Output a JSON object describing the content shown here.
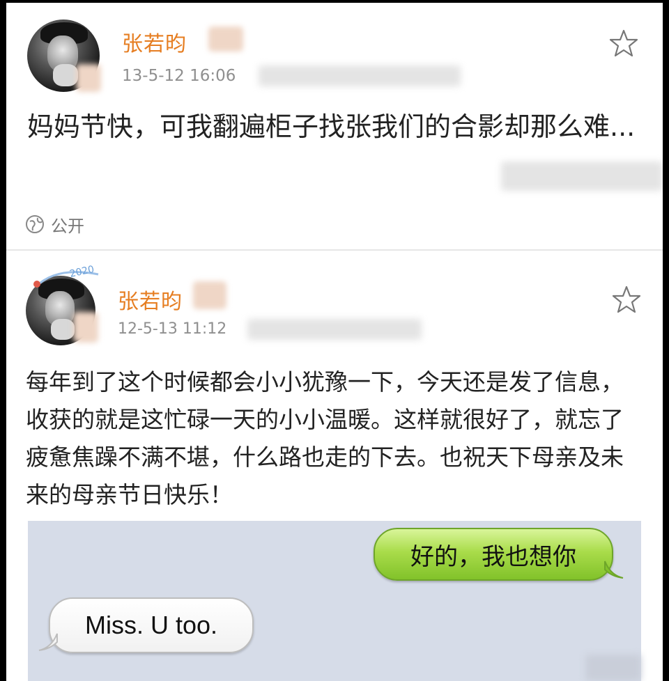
{
  "posts": [
    {
      "username": "张若昀",
      "timestamp": "13-5-12 16:06",
      "text": "妈妈节快，可我翻遍柜子找张我们的合影却那么难...",
      "privacy_label": "公开"
    },
    {
      "username": "张若昀",
      "timestamp": "12-5-13 11:12",
      "avatar_badge": "2020",
      "text": "每年到了这个时候都会小小犹豫一下，今天还是发了信息，收获的就是这忙碌一天的小小温暖。这样就很好了，就忘了疲惫焦躁不满不堪，什么路也走的下去。也祝天下母亲及未来的母亲节日快乐！"
    }
  ],
  "sms": {
    "sent_message": "好的，我也想你",
    "received_message": "Miss. U too."
  },
  "colors": {
    "username": "#e67e22",
    "timestamp": "#8f8f8f",
    "sent_bubble": "#a9dc4a",
    "sms_background": "#d6dce8"
  },
  "icons": [
    "star-icon",
    "globe-icon"
  ]
}
